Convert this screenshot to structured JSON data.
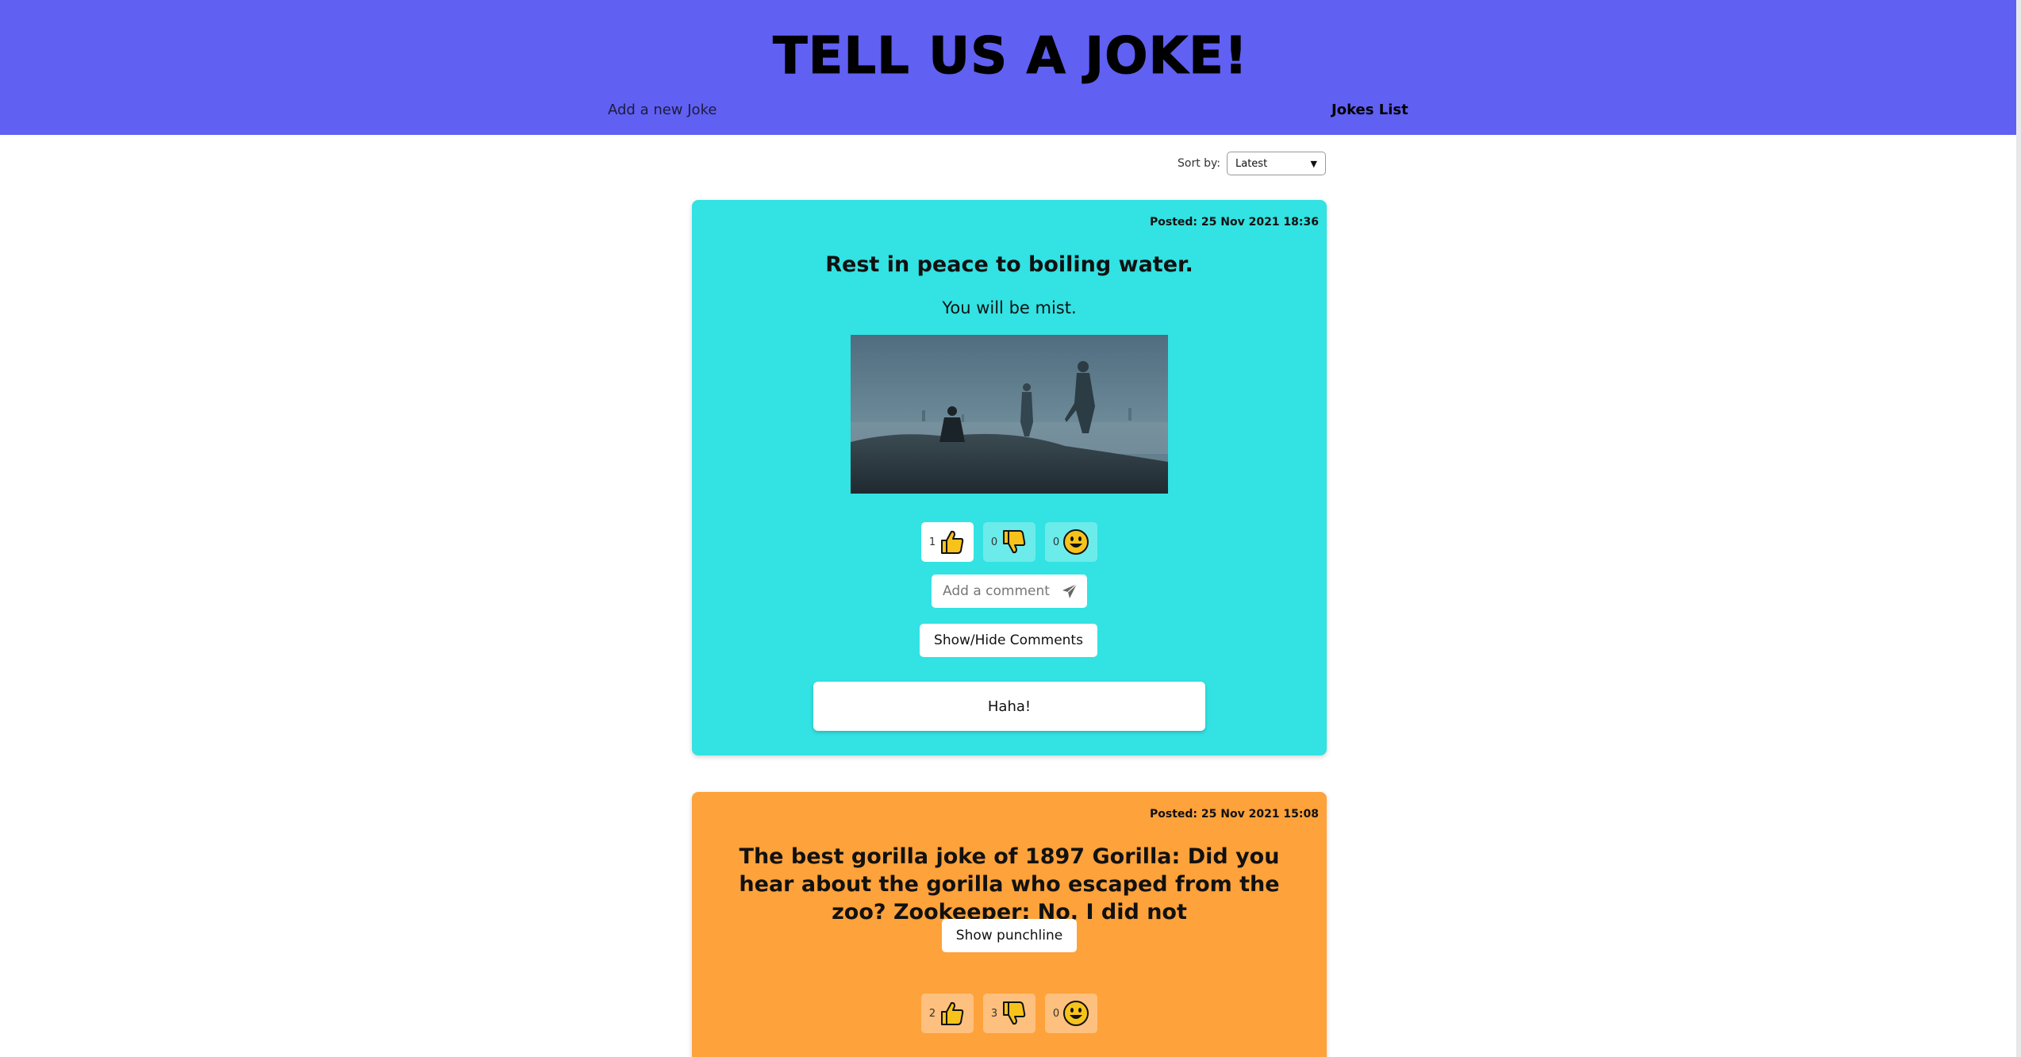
{
  "header": {
    "title": "Tell us a Joke!",
    "nav_add": "Add a new Joke",
    "nav_list": "Jokes List",
    "background_color": "#6060f2"
  },
  "sort": {
    "label": "Sort by:",
    "selected": "Latest"
  },
  "jokes": [
    {
      "posted": "Posted: 25 Nov 2021 18:36",
      "setup": "Rest in peace to boiling water.",
      "punchline": "You will be mist.",
      "card_color": "#33e2e2",
      "image_icon": "misty-landscape-image",
      "reactions": {
        "thumbs_up": "1",
        "thumbs_down": "0",
        "smile": "0"
      },
      "comment_placeholder": "Add a comment",
      "show_hide_comments": "Show/Hide Comments",
      "haha_label": "Haha!"
    },
    {
      "posted": "Posted: 25 Nov 2021 15:08",
      "setup": "The best gorilla joke of 1897 Gorilla: Did you hear about the gorilla who escaped from the zoo? Zookeeper: No, I did not",
      "card_color": "#fea23b",
      "show_punchline": "Show punchline",
      "reactions": {
        "thumbs_up": "2",
        "thumbs_down": "3",
        "smile": "0"
      }
    }
  ]
}
